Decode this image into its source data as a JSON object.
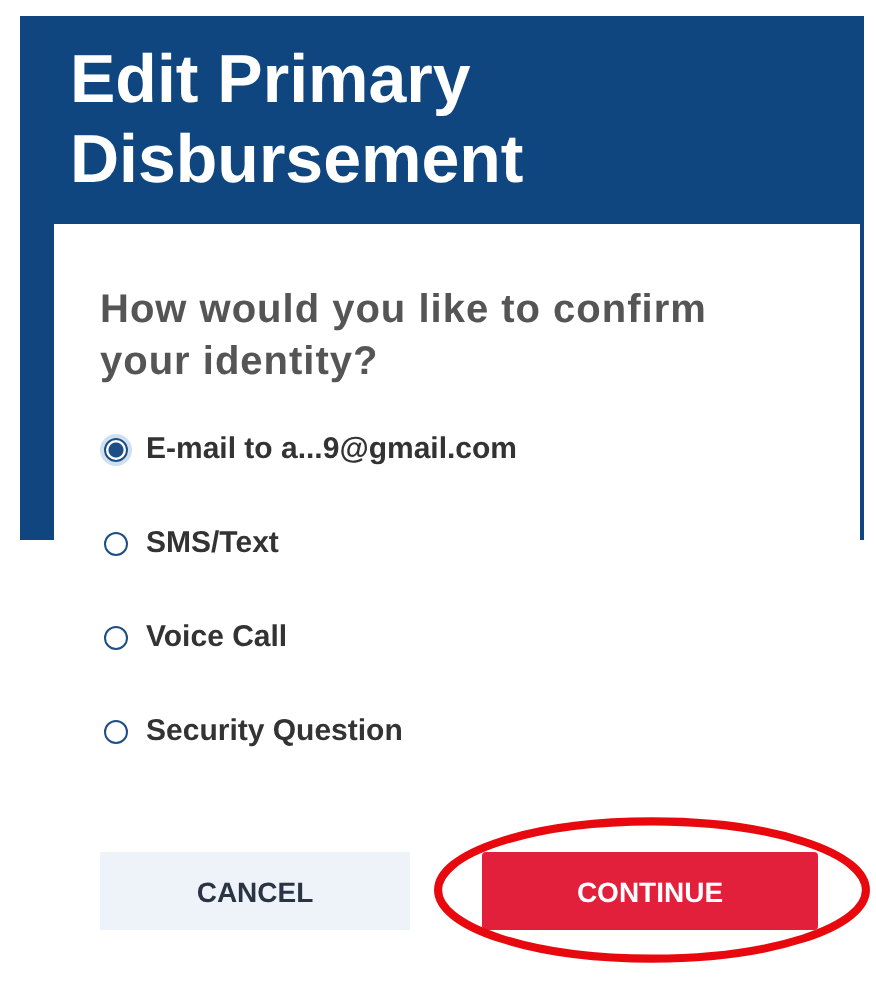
{
  "header": {
    "title": "Edit Primary Disbursement"
  },
  "question": "How would you like to confirm your identity?",
  "options": [
    {
      "label": "E-mail to a...9@gmail.com",
      "selected": true
    },
    {
      "label": "SMS/Text",
      "selected": false
    },
    {
      "label": "Voice Call",
      "selected": false
    },
    {
      "label": "Security Question",
      "selected": false
    }
  ],
  "buttons": [
    {
      "label": "CANCEL",
      "kind": "secondary"
    },
    {
      "label": "CONTINUE",
      "kind": "primary",
      "circled": true
    }
  ]
}
